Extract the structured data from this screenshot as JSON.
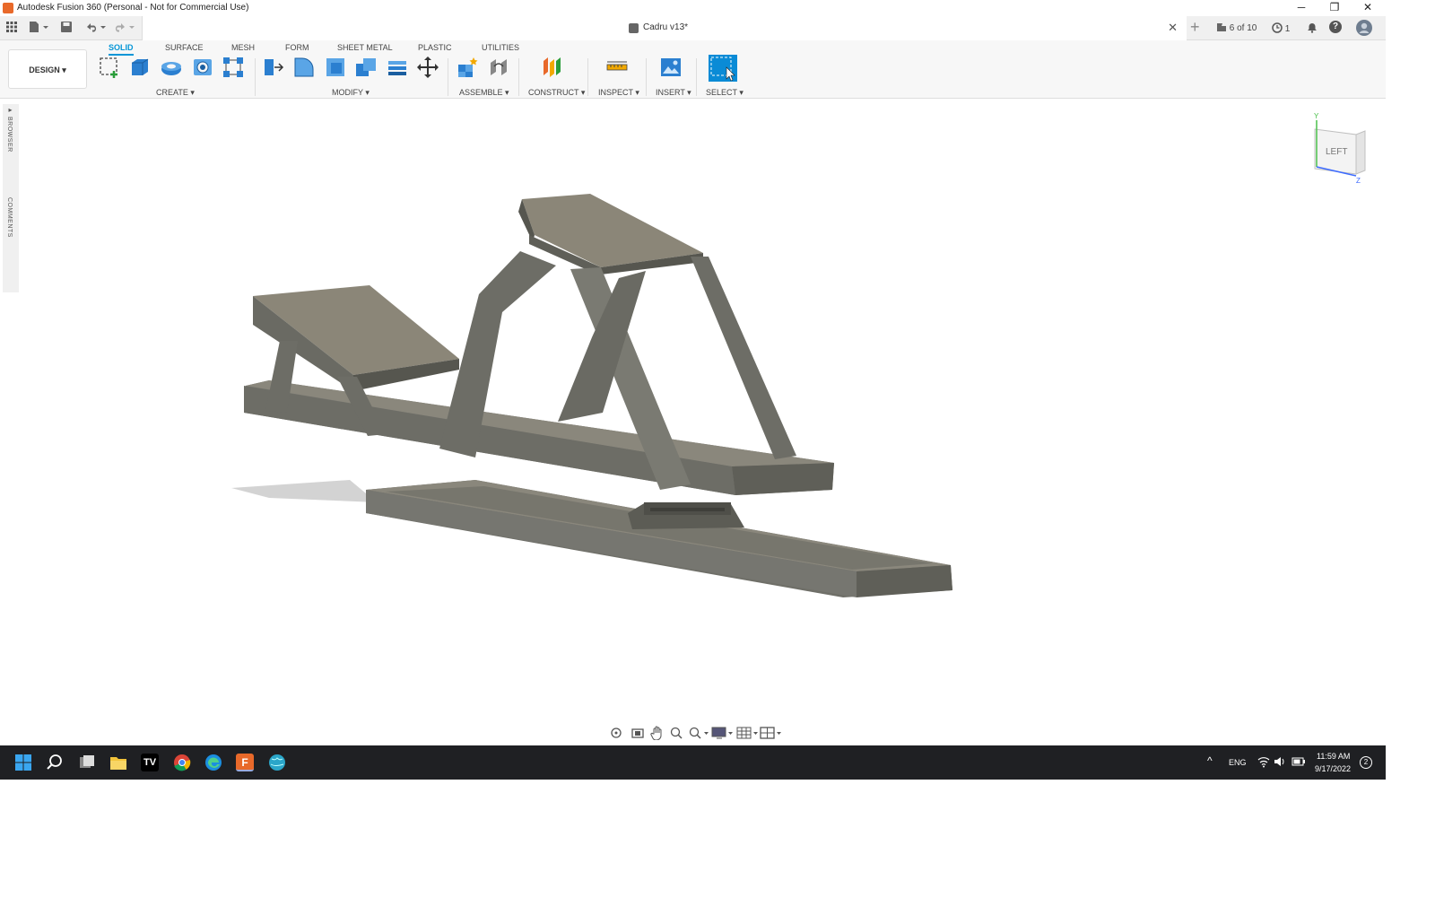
{
  "window": {
    "title": "Autodesk Fusion 360 (Personal - Not for Commercial Use)",
    "minimize_glyph": "─",
    "restore_glyph": "❐",
    "close_glyph": "✕"
  },
  "quick_access": {
    "document_name": "Cadru v13*",
    "close_glyph": "✕",
    "add_glyph": "+",
    "job_status": "6 of 10",
    "notifications_count": "1",
    "help_glyph": "?"
  },
  "toolbar": {
    "workspace_label": "DESIGN ▾",
    "tabs": [
      "SOLID",
      "SURFACE",
      "MESH",
      "FORM",
      "SHEET METAL",
      "PLASTIC",
      "UTILITIES"
    ],
    "groups": [
      "CREATE ▾",
      "MODIFY ▾",
      "ASSEMBLE ▾",
      "CONSTRUCT ▾",
      "INSPECT ▾",
      "INSERT ▾",
      "SELECT ▾"
    ]
  },
  "side_panel": {
    "browser_label": "BROWSER",
    "comments_label": "COMMENTS",
    "expand_glyph": "▸"
  },
  "viewcube": {
    "face_label": "LEFT",
    "axis_y": "Y",
    "axis_z": "Z"
  },
  "taskbar": {
    "language": "ENG",
    "time": "11:59 AM",
    "date": "9/17/2022",
    "notification_count": "2",
    "tray_expand_glyph": "^"
  },
  "colors": {
    "accent": "#0696d7",
    "model_face": "#7a7a72",
    "model_top": "#8b8678",
    "model_dark": "#5f5f58",
    "taskbar": "#1f2023"
  },
  "icons": {
    "titlebar": [
      "fusion-app-icon"
    ],
    "quick_access": [
      "grid-icon",
      "file-icon",
      "save-icon",
      "undo-icon",
      "redo-icon",
      "cube-doc-icon",
      "plus-icon",
      "job-status-icon",
      "clock-icon",
      "bell-icon",
      "help-icon",
      "user-avatar-icon"
    ],
    "taskbar": [
      "windows-start-icon",
      "search-icon",
      "task-view-icon",
      "file-explorer-icon",
      "tradingview-icon",
      "chrome-icon",
      "edge-icon",
      "fusion-icon",
      "globe-app-icon",
      "wifi-icon",
      "speaker-icon",
      "battery-icon"
    ]
  }
}
